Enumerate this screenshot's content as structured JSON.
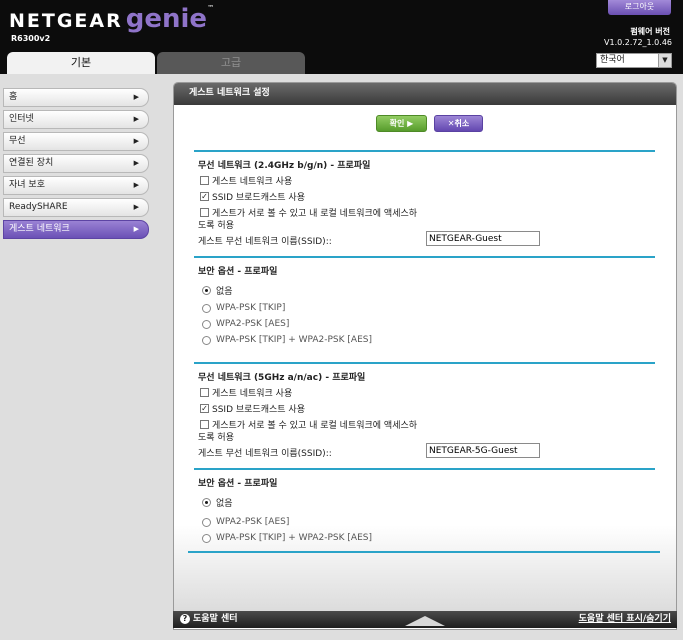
{
  "header": {
    "brand": "NETGEAR",
    "product": "genie",
    "tm": "™",
    "model": "R6300v2",
    "logout_label": "로그아웃",
    "firmware_label": "펌웨어 버전",
    "firmware_version": "V1.0.2.72_1.0.46",
    "language_selected": "한국어"
  },
  "tabs": [
    {
      "label": "기본"
    },
    {
      "label": "고급"
    }
  ],
  "sidebar": {
    "items": [
      {
        "label": "홈"
      },
      {
        "label": "인터넷"
      },
      {
        "label": "무선"
      },
      {
        "label": "연결된 장치"
      },
      {
        "label": "자녀 보호"
      },
      {
        "label": "ReadySHARE"
      },
      {
        "label": "게스트 네트워크"
      }
    ]
  },
  "panel": {
    "title": "게스트 네트워크 설정",
    "apply_label": "확인 ▶",
    "cancel_label": "✕취소"
  },
  "band24": {
    "title": "무선 네트워크 (2.4GHz b/g/n) - 프로파일",
    "enable_guest_label": "게스트 네트워크 사용",
    "enable_guest_checked": false,
    "ssid_broadcast_label": "SSID 브로드캐스트 사용",
    "ssid_broadcast_checked": true,
    "allow_access_label_line1": "게스트가 서로 볼 수 있고 내 로컬 네트워크에 액세스하",
    "allow_access_label_line2": "도록 허용",
    "allow_access_checked": false,
    "ssid_label": "게스트 무선 네트워크 이름(SSID)::",
    "ssid_value": "NETGEAR-Guest"
  },
  "security24": {
    "title": "보안 옵션 - 프로파일",
    "options": [
      "없음",
      "WPA-PSK [TKIP]",
      "WPA2-PSK [AES]",
      "WPA-PSK [TKIP] + WPA2-PSK [AES]"
    ],
    "selected": "없음"
  },
  "band5": {
    "title": "무선 네트워크 (5GHz a/n/ac) - 프로파일",
    "enable_guest_label": "게스트 네트워크 사용",
    "enable_guest_checked": false,
    "ssid_broadcast_label": "SSID 브로드캐스트 사용",
    "ssid_broadcast_checked": true,
    "allow_access_label_line1": "게스트가 서로 볼 수 있고 내 로컬 네트워크에 액세스하",
    "allow_access_label_line2": "도록 허용",
    "allow_access_checked": false,
    "ssid_label": "게스트 무선 네트워크 이름(SSID)::",
    "ssid_value": "NETGEAR-5G-Guest"
  },
  "security5": {
    "title": "보안 옵션 - 프로파일",
    "options": [
      "없음",
      "WPA2-PSK [AES]",
      "WPA-PSK [TKIP] + WPA2-PSK [AES]"
    ],
    "selected": "없음"
  },
  "footer": {
    "help_icon": "?",
    "help_center_label": "도움말 센터",
    "help_toggle_label": "도움말 센터 표시/숨기기"
  },
  "colors": {
    "accent_purple": "#6b51b6",
    "ok_green": "#579c2c",
    "separator_blue": "#2aa3c8"
  }
}
